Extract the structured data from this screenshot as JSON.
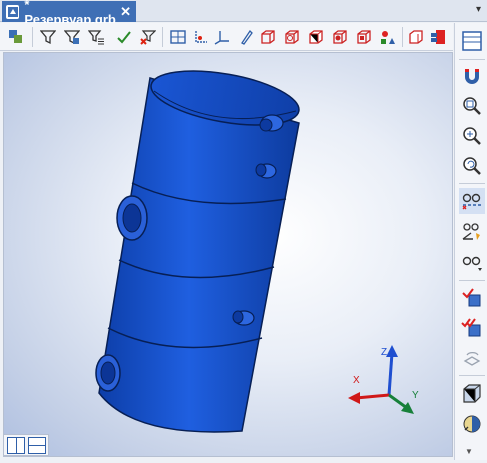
{
  "tab": {
    "title": "* Резервуар.grb",
    "close": "✕"
  },
  "dropdown": "▾",
  "toolbar": {
    "icons": [
      "layers-icon",
      "filter-icon",
      "filter-select-icon",
      "filter-list-icon",
      "check-filter-icon",
      "clear-filter-icon",
      "filter-alt-icon",
      "grid-view-icon",
      "axes-origin-icon",
      "axes-3d-icon",
      "sketch-icon",
      "box-wire-icon",
      "box-solid-icon",
      "box-shade-icon",
      "box-edge-icon",
      "box-hidden-icon",
      "shapes-icon",
      "box-section-icon",
      "component-icon"
    ]
  },
  "rightbar": {
    "icons": [
      "layout-icon",
      "magnet-icon",
      "zoom-window-icon",
      "zoom-fit-icon",
      "zoom-prev-icon",
      "glasses-dash-icon",
      "glasses-angle-icon",
      "glasses-dropdown-icon",
      "check-cube-icon",
      "check-cube-multi-icon",
      "rotate-icon",
      "view-cube-icon",
      "sphere-icon"
    ]
  },
  "axes": {
    "x": "X",
    "y": "Y",
    "z": "Z"
  },
  "colors": {
    "model": "#1a57d6",
    "tab": "#3f6fb5"
  }
}
